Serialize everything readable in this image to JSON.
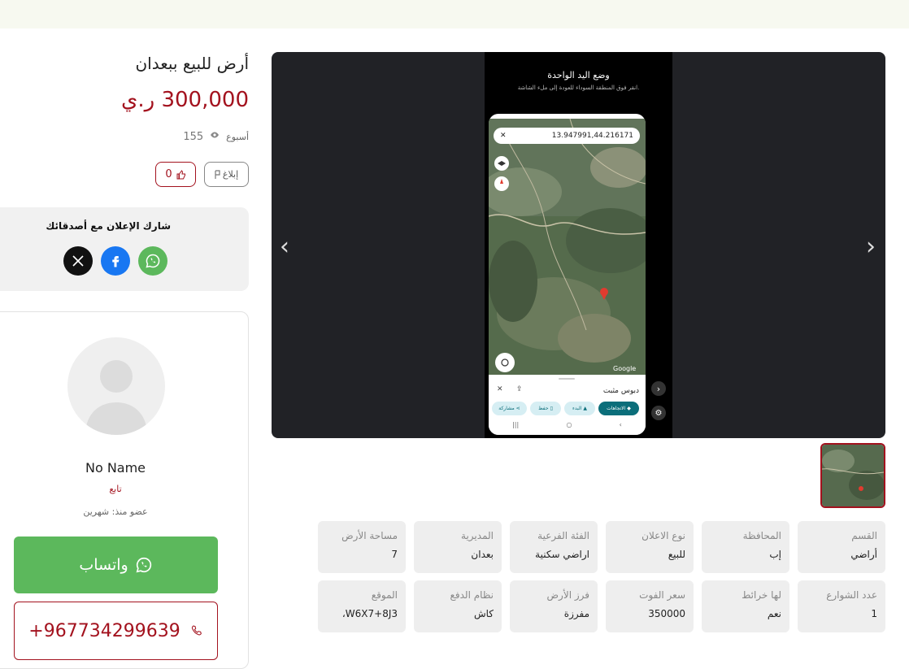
{
  "listing": {
    "title": "أرض للبيع ببعدان",
    "price": "300,000 ر.ي",
    "age": "أسبوع",
    "views": "155",
    "report_label": "إبلاغ",
    "likes": "0"
  },
  "share": {
    "title": "شارك الإعلان مع أصدقائك",
    "icons": [
      "whatsapp-icon",
      "facebook-icon",
      "x-icon"
    ],
    "colors": {
      "whatsapp": "#5cb85c",
      "facebook": "#1877f2",
      "x": "#111111"
    }
  },
  "seller": {
    "name": "No Name",
    "role": "تابع",
    "member_since": "عضو منذ: شهرين",
    "whatsapp_label": "واتساب",
    "phone": "+967734299639"
  },
  "gallery": {
    "phone_title": "وضع اليد الواحدة",
    "phone_subtitle": "انقر فوق المنطقة السوداء للعودة إلى ملء الشاشة.",
    "coordinates": "13.947991,44.216171",
    "pin_title": "دبوس مثبت",
    "chip_directions": "الاتجاهات",
    "chip_start": "البدء",
    "chip_save": "حفظ",
    "chip_share": "مشاركة",
    "map_brand": "Google"
  },
  "attributes": [
    {
      "label": "القسم",
      "value": "أراضي"
    },
    {
      "label": "المحافظة",
      "value": "إب"
    },
    {
      "label": "نوع الاعلان",
      "value": "للبيع"
    },
    {
      "label": "الفئة الفرعية",
      "value": "اراضي سكنية"
    },
    {
      "label": "المديرية",
      "value": "بعدان"
    },
    {
      "label": "مساحة الأرض",
      "value": "7"
    },
    {
      "label": "عدد الشوارع",
      "value": "1"
    },
    {
      "label": "لها خرائط",
      "value": "نعم"
    },
    {
      "label": "سعر الفوت",
      "value": "350000"
    },
    {
      "label": "فرز الأرض",
      "value": "مفرزة"
    },
    {
      "label": "نظام الدفع",
      "value": "كاش"
    },
    {
      "label": "الموقع",
      "value": "W6X7+8J3،"
    }
  ],
  "accent_color": "#a3121e"
}
